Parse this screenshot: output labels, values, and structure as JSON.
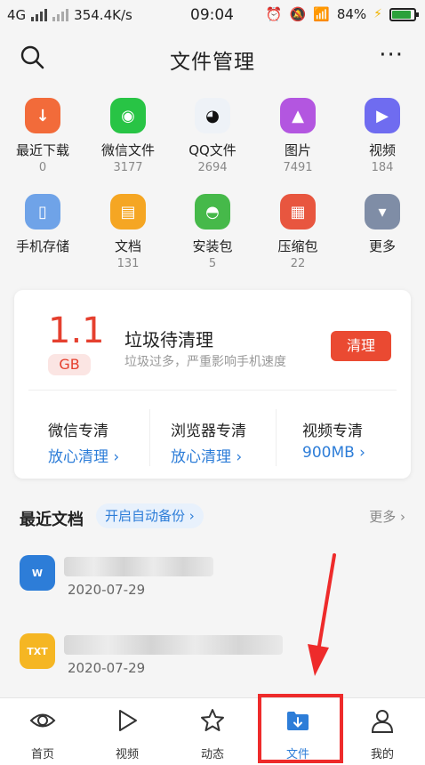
{
  "status_bar": {
    "network": "4G",
    "speed": "354.4K/s",
    "time": "09:04",
    "battery": "84%"
  },
  "header": {
    "title": "文件管理"
  },
  "categories": [
    {
      "label": "最近下载",
      "count": "0",
      "color": "#f26b3a",
      "icon": "download-icon"
    },
    {
      "label": "微信文件",
      "count": "3177",
      "color": "#28c445",
      "icon": "wechat-icon"
    },
    {
      "label": "QQ文件",
      "count": "2694",
      "color": "#eef2f7",
      "icon": "qq-penguin-icon"
    },
    {
      "label": "图片",
      "count": "7491",
      "color": "#b356e0",
      "icon": "image-icon"
    },
    {
      "label": "视频",
      "count": "184",
      "color": "#6f6cf0",
      "icon": "video-icon"
    },
    {
      "label": "手机存储",
      "count": "",
      "color": "#6fa3e8",
      "icon": "phone-storage-icon"
    },
    {
      "label": "文档",
      "count": "131",
      "color": "#f5a623",
      "icon": "document-icon"
    },
    {
      "label": "安装包",
      "count": "5",
      "color": "#46b94a",
      "icon": "android-icon"
    },
    {
      "label": "压缩包",
      "count": "22",
      "color": "#e8563f",
      "icon": "zip-icon"
    },
    {
      "label": "更多",
      "count": "",
      "color": "#7f8da6",
      "icon": "chevron-down-icon"
    }
  ],
  "cleaner": {
    "size": "1.1",
    "unit": "GB",
    "title": "垃圾待清理",
    "subtitle": "垃圾过多，严重影响手机速度",
    "button": "清理",
    "options": [
      {
        "title": "微信专清",
        "value": "放心清理 ›"
      },
      {
        "title": "浏览器专清",
        "value": "放心清理 ›"
      },
      {
        "title": "视频专清",
        "value": "900MB ›"
      }
    ]
  },
  "recent": {
    "title": "最近文档",
    "backup": "开启自动备份 ›",
    "more": "更多 ›",
    "docs": [
      {
        "type": "W",
        "date": "2020-07-29",
        "color": "#2d7dd8"
      },
      {
        "type": "TXT",
        "date": "2020-07-29",
        "color": "#f5b623"
      }
    ]
  },
  "tabs": [
    {
      "label": "首页",
      "icon": "eye-icon"
    },
    {
      "label": "视频",
      "icon": "play-icon"
    },
    {
      "label": "动态",
      "icon": "star-icon"
    },
    {
      "label": "文件",
      "icon": "folder-download-icon"
    },
    {
      "label": "我的",
      "icon": "user-icon"
    }
  ],
  "colors": {
    "accent": "#2d7dd8",
    "danger": "#e5402f",
    "highlight": "#ee2b2b"
  }
}
